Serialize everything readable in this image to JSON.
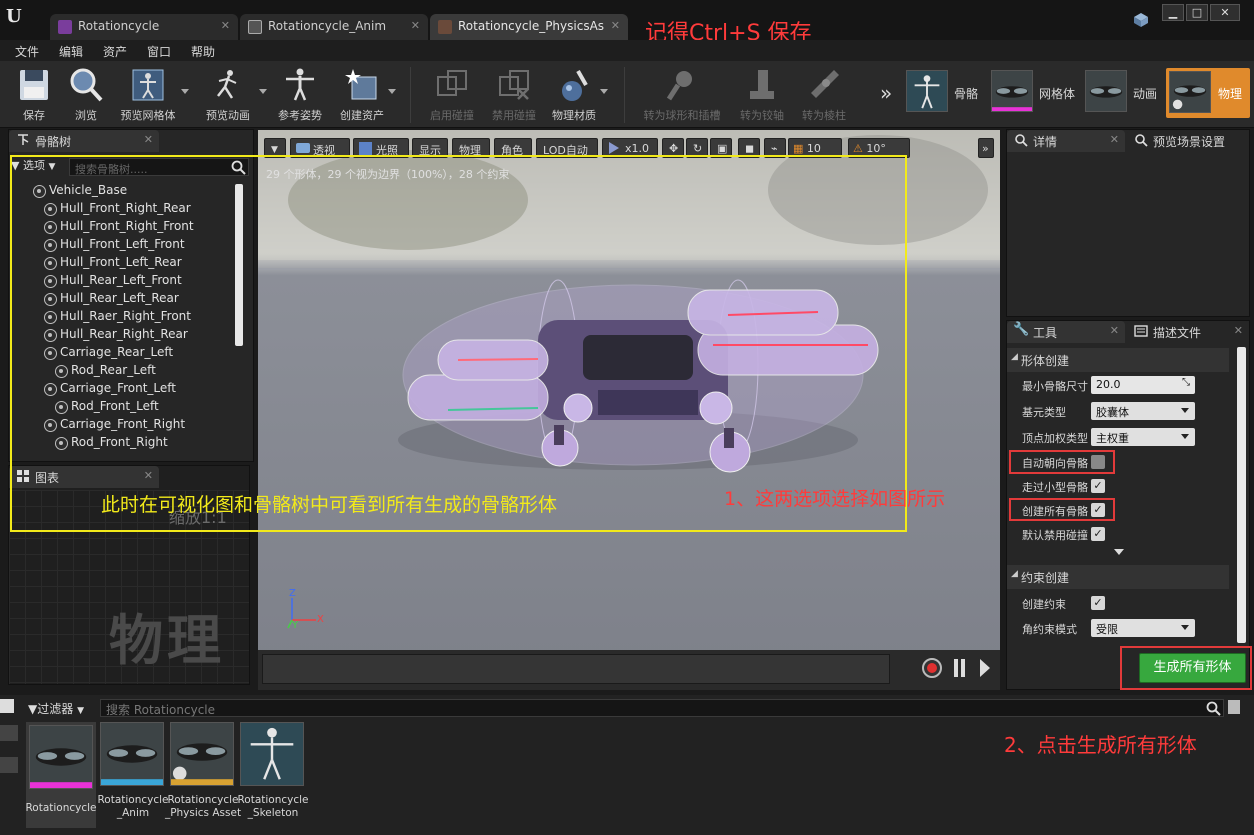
{
  "tabs": [
    {
      "label": "Rotationcycle",
      "active": false
    },
    {
      "label": "Rotationcycle_Anim",
      "active": false
    },
    {
      "label": "Rotationcycle_PhysicsAs",
      "active": true
    }
  ],
  "annotations": {
    "save_note": "记得Ctrl+S 保存",
    "viewport_note": "此时在可视化图和骨骼树中可看到所有生成的骨骼形体",
    "step1_note": "1、这两选项选择如图所示",
    "step2_note": "2、点击生成所有形体",
    "accent_color": "#ff3b3b",
    "highlight_color": "#f2ea1a"
  },
  "menu": [
    "文件",
    "编辑",
    "资产",
    "窗口",
    "帮助"
  ],
  "toolbar": {
    "buttons": [
      {
        "label": "保存",
        "icon": "save-icon",
        "enabled": true
      },
      {
        "label": "浏览",
        "icon": "browse-icon",
        "enabled": true
      },
      {
        "label": "预览网格体",
        "icon": "preview-mesh-icon",
        "enabled": true
      },
      {
        "label": "预览动画",
        "icon": "preview-anim-icon",
        "enabled": true
      },
      {
        "label": "参考姿势",
        "icon": "ref-pose-icon",
        "enabled": true
      },
      {
        "label": "创建资产",
        "icon": "create-asset-icon",
        "enabled": true
      },
      {
        "label": "启用碰撞",
        "icon": "enable-collision-icon",
        "enabled": false
      },
      {
        "label": "禁用碰撞",
        "icon": "disable-collision-icon",
        "enabled": false
      },
      {
        "label": "物理材质",
        "icon": "physics-material-icon",
        "enabled": true
      },
      {
        "label": "转为球形和插槽",
        "icon": "ball-socket-icon",
        "enabled": false
      },
      {
        "label": "转为铰轴",
        "icon": "hinge-icon",
        "enabled": false
      },
      {
        "label": "转为棱柱",
        "icon": "prismatic-icon",
        "enabled": false
      }
    ],
    "modes": [
      {
        "label": "骨骼",
        "icon": "skeleton-mode-icon"
      },
      {
        "label": "网格体",
        "icon": "mesh-mode-icon"
      },
      {
        "label": "动画",
        "icon": "animation-mode-icon"
      },
      {
        "label": "物理",
        "icon": "physics-mode-icon",
        "active": true
      }
    ]
  },
  "skeleton_tree": {
    "tab": "骨骼树",
    "options_label": "选项",
    "search_placeholder": "搜索骨骼树.....",
    "bones": [
      {
        "name": "Vehicle_Base",
        "depth": 0
      },
      {
        "name": "Hull_Front_Right_Rear",
        "depth": 1
      },
      {
        "name": "Hull_Front_Right_Front",
        "depth": 1
      },
      {
        "name": "Hull_Front_Left_Front",
        "depth": 1
      },
      {
        "name": "Hull_Front_Left_Rear",
        "depth": 1
      },
      {
        "name": "Hull_Rear_Left_Front",
        "depth": 1
      },
      {
        "name": "Hull_Rear_Left_Rear",
        "depth": 1
      },
      {
        "name": "Hull_Raer_Right_Front",
        "depth": 1
      },
      {
        "name": "Hull_Rear_Right_Rear",
        "depth": 1
      },
      {
        "name": "Carriage_Rear_Left",
        "depth": 1
      },
      {
        "name": "Rod_Rear_Left",
        "depth": 2
      },
      {
        "name": "Carriage_Front_Left",
        "depth": 1
      },
      {
        "name": "Rod_Front_Left",
        "depth": 2
      },
      {
        "name": "Carriage_Front_Right",
        "depth": 1
      },
      {
        "name": "Rod_Front_Right",
        "depth": 2
      }
    ]
  },
  "graph": {
    "tab": "图表",
    "zoom_label": "缩放1:1",
    "watermark": "物理"
  },
  "viewport": {
    "buttons": {
      "perspective": "透视",
      "lit": "光照",
      "show": "显示",
      "physics": "物理",
      "character": "角色",
      "lod": "LOD自动",
      "speed": "x1.0",
      "grid": "10",
      "angle": "10°"
    },
    "stats": "29 个形体，29 个视为边界（100%），28 个约束",
    "axis": {
      "x": "X",
      "z": "Z",
      "y": "Y"
    }
  },
  "details": {
    "tab_details": "详情",
    "tab_preview": "预览场景设置"
  },
  "tools": {
    "tab_tools": "工具",
    "tab_profile": "描述文件",
    "body_section": "形体创建",
    "min_bone_size_label": "最小骨骼尺寸",
    "min_bone_size": "20.0",
    "primitive_type_label": "基元类型",
    "primitive_type": "胶囊体",
    "vertex_weight_label": "顶点加权类型",
    "vertex_weight": "主权重",
    "auto_orient_label": "自动朝向骨骼",
    "auto_orient": false,
    "walk_past_small_label": "走过小型骨骼",
    "walk_past_small": true,
    "create_all_bones_label": "创建所有骨骼",
    "create_all_bones": true,
    "disable_collision_label": "默认禁用碰撞",
    "disable_collision": true,
    "constraint_section": "约束创建",
    "create_constraints_label": "创建约束",
    "create_constraints": true,
    "angular_mode_label": "角约束模式",
    "angular_mode": "受限",
    "generate_button": "生成所有形体"
  },
  "content_browser": {
    "filter_label": "过滤器",
    "search_placeholder": "搜索 Rotationcycle",
    "assets": [
      {
        "name": "Rotationcycle",
        "icon": "skeletal-mesh-icon",
        "bar_color": "#e832d8"
      },
      {
        "name": "Rotationcycle _Anim",
        "icon": "anim-sequence-icon",
        "bar_color": ""
      },
      {
        "name": "Rotationcycle _Physics Asset",
        "icon": "physics-asset-icon",
        "bar_color": ""
      },
      {
        "name": "Rotationcycle _Skeleton",
        "icon": "skeleton-asset-icon",
        "bar_color": ""
      }
    ]
  }
}
